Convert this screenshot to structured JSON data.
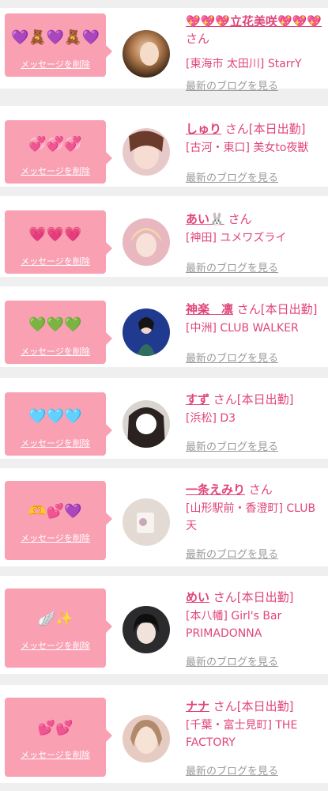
{
  "common": {
    "delete_label": "メッセージを削除",
    "blog_label": "最新のブログを見る",
    "colors": {
      "accent": "#e0457a",
      "bubble": "#f9a0b3",
      "muted": "#9a9a9a"
    }
  },
  "girls": [
    {
      "message": "💜🧸💜🧸💜",
      "name": "💖💖💖立花美咲💖💖💖",
      "suffix": " さん",
      "status": "",
      "shop": "[東海市 太田川] StarrY"
    },
    {
      "message": "💞💞💞",
      "name": "しゅり",
      "suffix": " さん",
      "status": "[本日出勤]",
      "shop": "[古河・東口] 美女to夜獣"
    },
    {
      "message": "💗💗💗",
      "name": "あい🐰",
      "suffix": " さん",
      "status": "",
      "shop": "[神田] ユメワズライ"
    },
    {
      "message": "💚💚💚",
      "name": "神楽　凛",
      "suffix": " さん",
      "status": "[本日出勤]",
      "shop": "[中洲] CLUB WALKER"
    },
    {
      "message": "🩵🩵🩵",
      "name": "すず",
      "suffix": " さん",
      "status": "[本日出勤]",
      "shop": "[浜松] D3"
    },
    {
      "message": "🫶💕💜",
      "name": "一条えみり",
      "suffix": " さん",
      "status": "",
      "shop": "[山形駅前・香澄町] CLUB 天"
    },
    {
      "message": "🪽✨",
      "name": "めい",
      "suffix": " さん",
      "status": "[本日出勤]",
      "shop": "[本八幡] Girl's Bar PRIMADONNA"
    },
    {
      "message": "💕💕",
      "name": "ナナ",
      "suffix": " さん",
      "status": "[本日出勤]",
      "shop": "[千葉・富士見町] THE FACTORY"
    }
  ]
}
